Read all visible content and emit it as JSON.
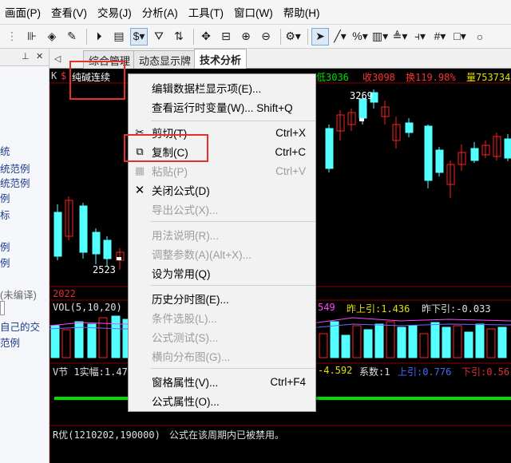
{
  "menubar": [
    "画面(P)",
    "查看(V)",
    "交易(J)",
    "分析(A)",
    "工具(T)",
    "窗口(W)",
    "帮助(H)"
  ],
  "toolbar": {
    "icons": [
      "cursor-icon",
      "draw-line-icon",
      "percent-icon",
      "grid-icon",
      "fibonacci-icon"
    ]
  },
  "left_panel": {
    "items": [
      "统",
      "统范例",
      "统范例",
      "例",
      "标",
      "例",
      "例",
      "例",
      "(未编译)",
      "自己的交",
      "范例"
    ]
  },
  "tabs": [
    "综合管理",
    "动态显示牌",
    "技术分析"
  ],
  "chart": {
    "stock_name": "纯碱连续",
    "header_items": [
      {
        "text": "高",
        "color": "#e00000"
      },
      {
        "text": "低3036",
        "color": "#00e000"
      },
      {
        "text": "收3098",
        "color": "#e00000"
      },
      {
        "text": "换119.98%",
        "color": "#e00000"
      },
      {
        "text": "量753734",
        "color": "#e0e000"
      }
    ],
    "price_labels": {
      "high": "3269",
      "low": "2523"
    },
    "year_label": "2022",
    "vol_label": "VOL(5,10,20) V",
    "vol_right": [
      {
        "text": "549",
        "color": "#ff44ff"
      },
      {
        "text": "昨上引:1.436",
        "color": "#e0e000"
      },
      {
        "text": "昨下引:-0.033",
        "color": "#e0e0e0"
      }
    ],
    "v_label": "V节 1实幅:1.47",
    "v_right": [
      {
        "text": "-4.592",
        "color": "#e0e000"
      },
      {
        "text": "系数:1",
        "color": "#e0e0e0"
      },
      {
        "text": "上引:0.776",
        "color": "#3f6bff"
      },
      {
        "text": "下引:0.56",
        "color": "#e00000"
      }
    ],
    "r_label": "R优(1210202,190000)",
    "r_message": "公式在该周期内已被禁用。"
  },
  "context_menu": {
    "items": [
      {
        "label": "编辑数据栏显示项(E)...",
        "shortcut": "",
        "disabled": false,
        "icon": ""
      },
      {
        "label": "查看运行时变量(W)... Shift+Q",
        "shortcut": "",
        "disabled": false,
        "icon": ""
      },
      {
        "label": "剪切(T)",
        "shortcut": "Ctrl+X",
        "disabled": false,
        "icon": "scissors-icon"
      },
      {
        "label": "复制(C)",
        "shortcut": "Ctrl+C",
        "disabled": false,
        "icon": "copy-icon"
      },
      {
        "label": "粘贴(P)",
        "shortcut": "Ctrl+V",
        "disabled": true,
        "icon": "paste-icon"
      },
      {
        "label": "关闭公式(D)",
        "shortcut": "",
        "disabled": false,
        "icon": "close-x-icon"
      },
      {
        "label": "导出公式(X)...",
        "shortcut": "",
        "disabled": true,
        "icon": ""
      },
      {
        "label": "用法说明(R)...",
        "shortcut": "",
        "disabled": true,
        "icon": ""
      },
      {
        "label": "调整参数(A)(Alt+X)...",
        "shortcut": "",
        "disabled": true,
        "icon": ""
      },
      {
        "label": "设为常用(Q)",
        "shortcut": "",
        "disabled": false,
        "icon": ""
      },
      {
        "label": "历史分时图(E)...",
        "shortcut": "",
        "disabled": false,
        "icon": ""
      },
      {
        "label": "条件选股(L)...",
        "shortcut": "",
        "disabled": true,
        "icon": ""
      },
      {
        "label": "公式测试(S)...",
        "shortcut": "",
        "disabled": true,
        "icon": ""
      },
      {
        "label": "横向分布图(G)...",
        "shortcut": "",
        "disabled": true,
        "icon": ""
      },
      {
        "label": "窗格属性(V)...",
        "shortcut": "Ctrl+F4",
        "disabled": false,
        "icon": ""
      },
      {
        "label": "公式属性(O)...",
        "shortcut": "",
        "disabled": false,
        "icon": ""
      }
    ]
  }
}
